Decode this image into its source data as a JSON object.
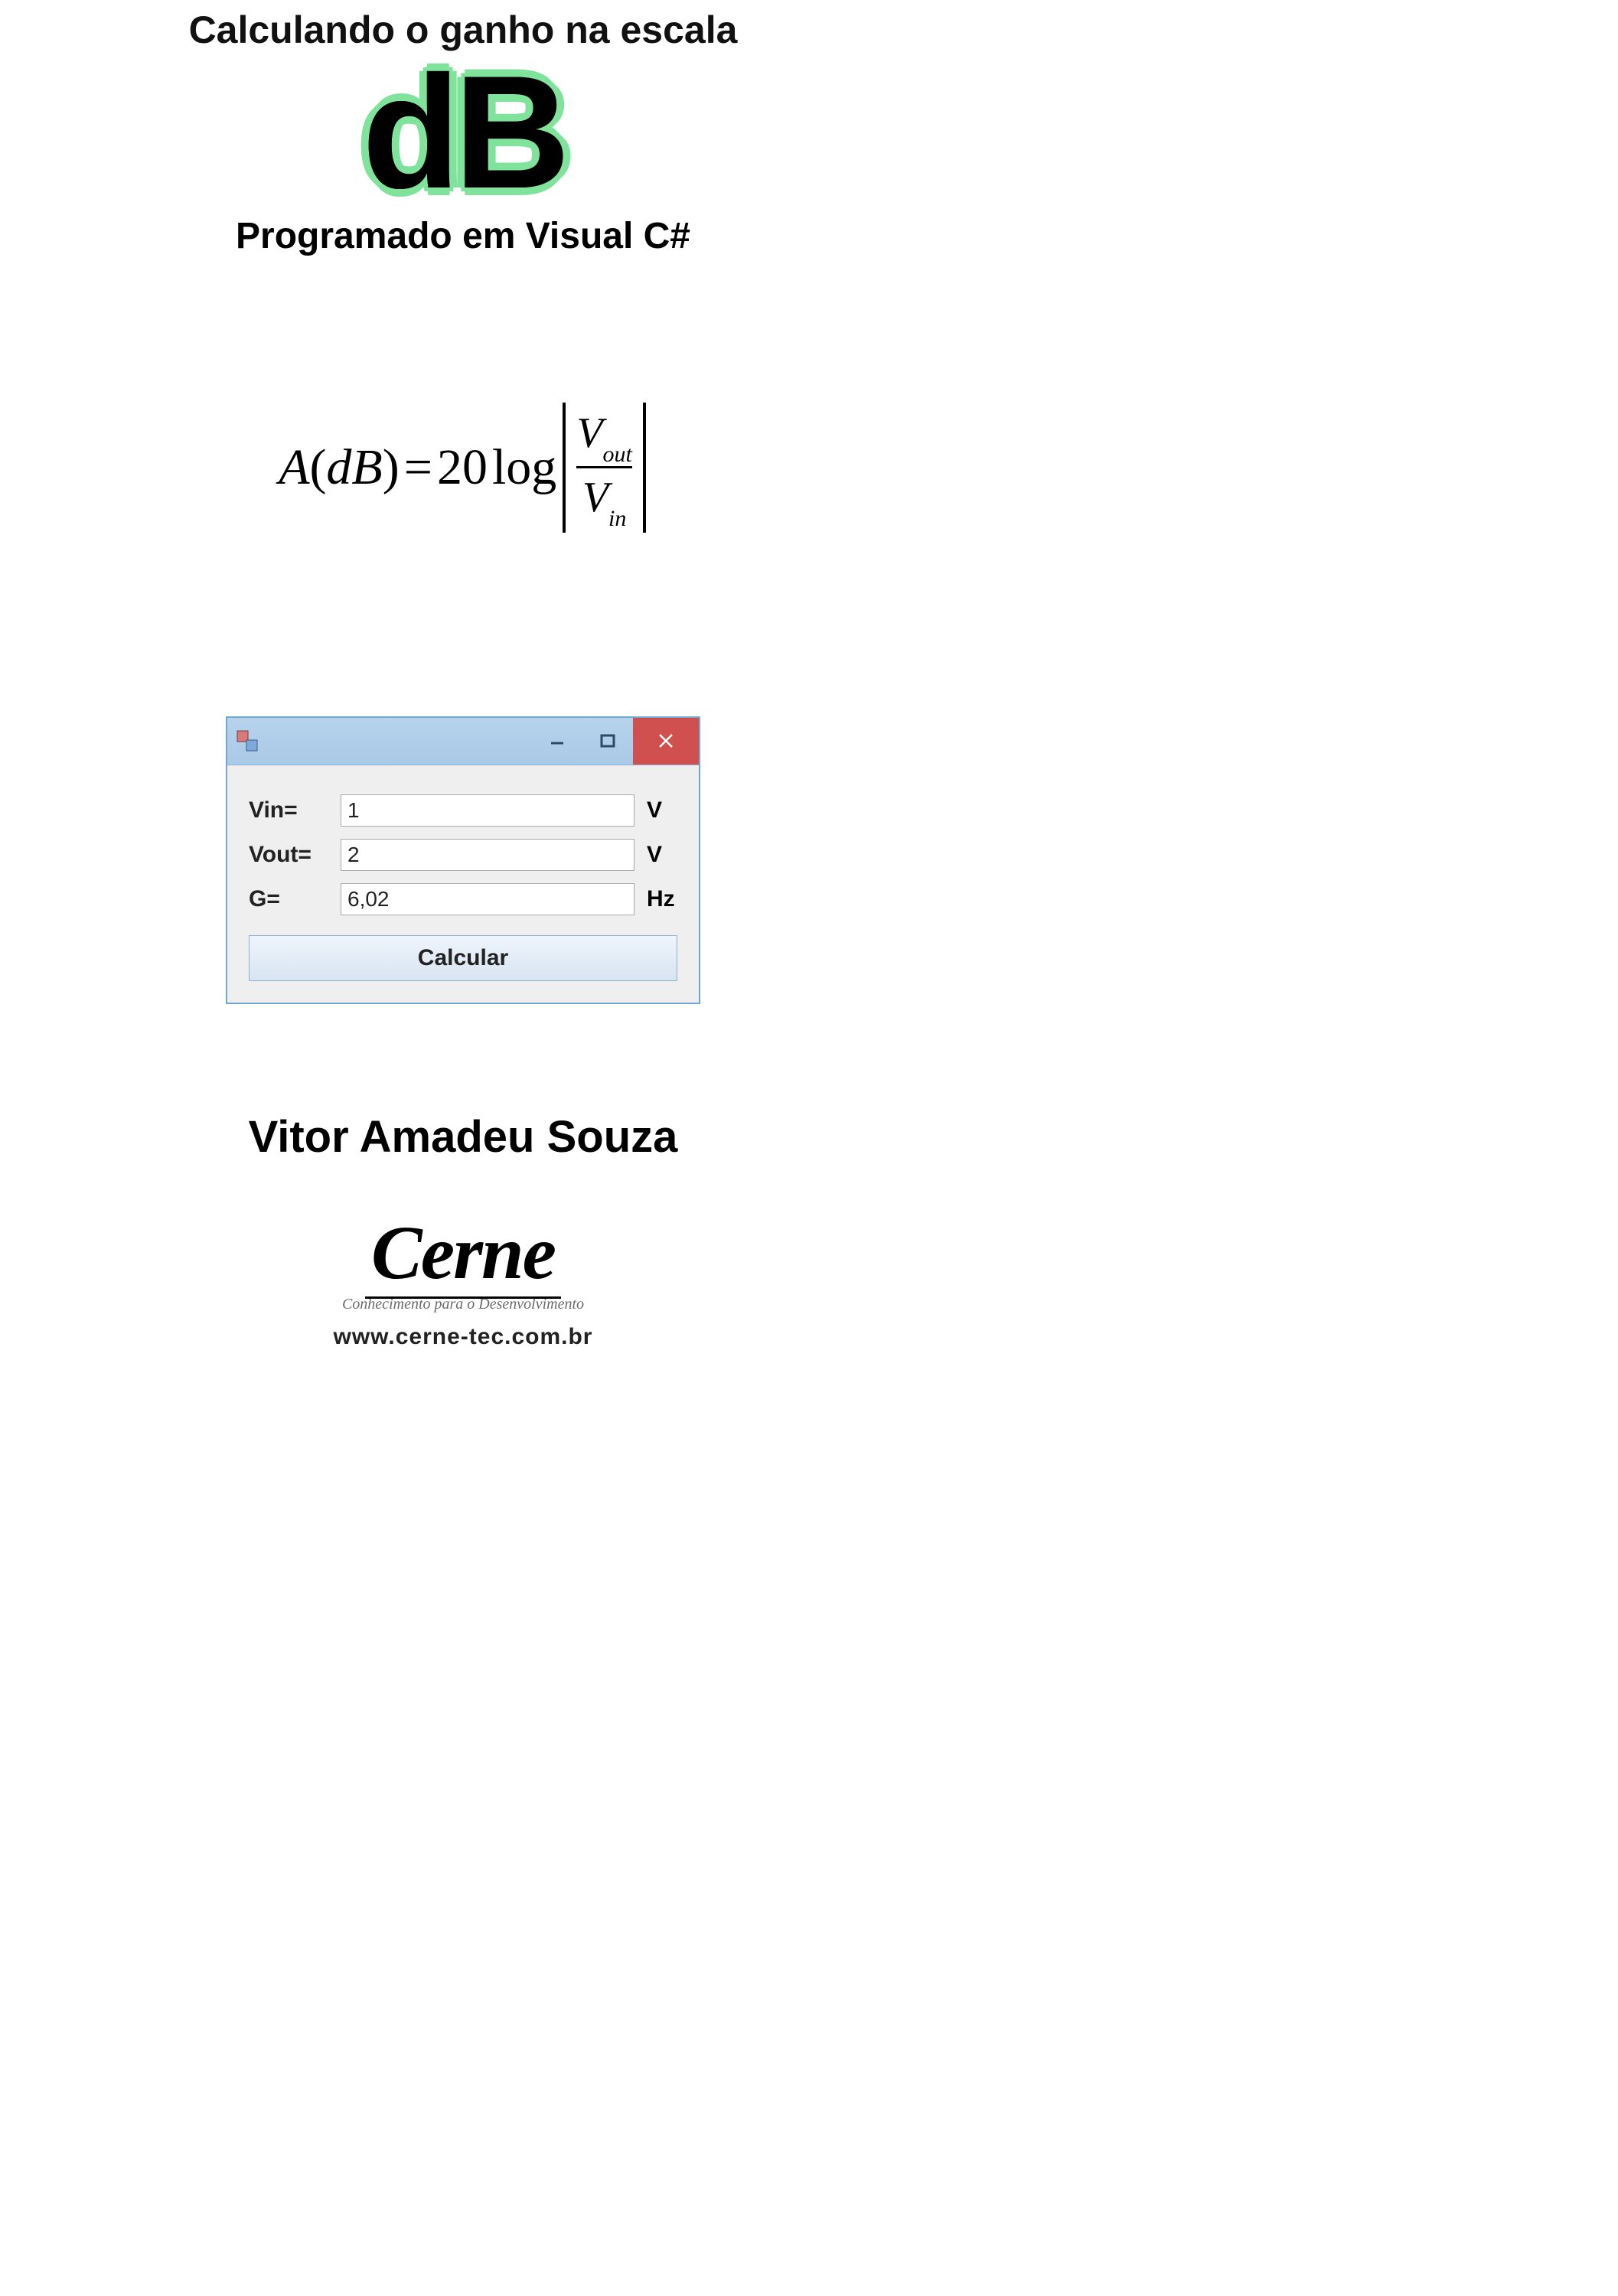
{
  "header": {
    "line1": "Calculando o ganho na escala",
    "logo_text": "dB",
    "subtitle": "Programado em Visual C#"
  },
  "formula": {
    "lhs_a": "A",
    "lhs_unit": "dB",
    "coef": "20",
    "log": "log",
    "num_main": "V",
    "num_sub": "out",
    "den_main": "V",
    "den_sub": "in"
  },
  "app": {
    "fields": [
      {
        "label": "Vin=",
        "value": "1",
        "unit": "V"
      },
      {
        "label": "Vout=",
        "value": "2",
        "unit": "V"
      },
      {
        "label": "G=",
        "value": "6,02",
        "unit": "Hz"
      }
    ],
    "calc_label": "Calcular"
  },
  "author": "Vitor Amadeu Souza",
  "brand": {
    "name": "Cerne",
    "tagline": "Conhecimento para o Desenvolvimento",
    "url": "www.cerne-tec.com.br"
  }
}
